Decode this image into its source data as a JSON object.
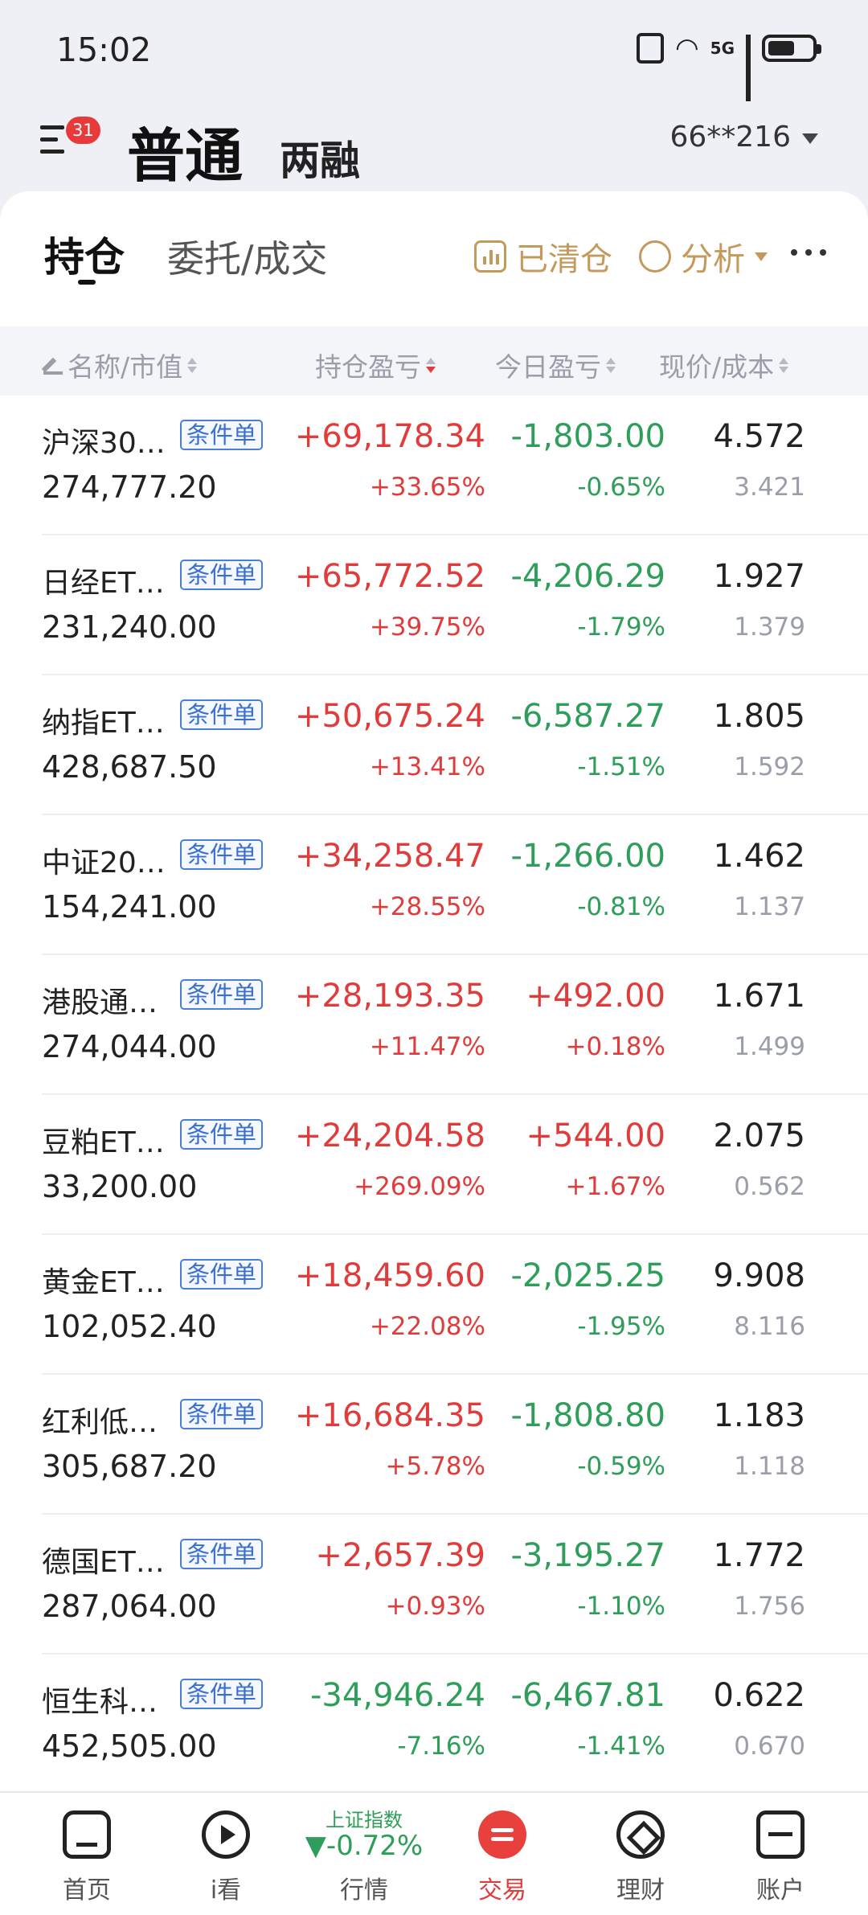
{
  "status": {
    "time": "15:02",
    "network": "5G"
  },
  "header": {
    "badge_count": "31",
    "account_type": "普通",
    "account_type_alt": "两融",
    "account_number": "66**216"
  },
  "tabs": {
    "active": "持仓",
    "inactive": "委托/成交"
  },
  "tools": {
    "cleared": "已清仓",
    "analysis": "分析"
  },
  "columns": {
    "name": "名称/市值",
    "pl": "持仓盈亏",
    "today": "今日盈亏",
    "price": "现价/成本"
  },
  "tag_label": "条件单",
  "holdings": [
    {
      "name": "沪深30…",
      "market_value": "274,777.20",
      "pl": "+69,178.34",
      "pl_pct": "+33.65%",
      "today": "-1,803.00",
      "today_pct": "-0.65%",
      "price": "4.572",
      "cost": "3.421"
    },
    {
      "name": "日经ET…",
      "market_value": "231,240.00",
      "pl": "+65,772.52",
      "pl_pct": "+39.75%",
      "today": "-4,206.29",
      "today_pct": "-1.79%",
      "price": "1.927",
      "cost": "1.379"
    },
    {
      "name": "纳指ET…",
      "market_value": "428,687.50",
      "pl": "+50,675.24",
      "pl_pct": "+13.41%",
      "today": "-6,587.27",
      "today_pct": "-1.51%",
      "price": "1.805",
      "cost": "1.592"
    },
    {
      "name": "中证20…",
      "market_value": "154,241.00",
      "pl": "+34,258.47",
      "pl_pct": "+28.55%",
      "today": "-1,266.00",
      "today_pct": "-0.81%",
      "price": "1.462",
      "cost": "1.137"
    },
    {
      "name": "港股通…",
      "market_value": "274,044.00",
      "pl": "+28,193.35",
      "pl_pct": "+11.47%",
      "today": "+492.00",
      "today_pct": "+0.18%",
      "price": "1.671",
      "cost": "1.499"
    },
    {
      "name": "豆粕ET…",
      "market_value": "33,200.00",
      "pl": "+24,204.58",
      "pl_pct": "+269.09%",
      "today": "+544.00",
      "today_pct": "+1.67%",
      "price": "2.075",
      "cost": "0.562"
    },
    {
      "name": "黄金ET…",
      "market_value": "102,052.40",
      "pl": "+18,459.60",
      "pl_pct": "+22.08%",
      "today": "-2,025.25",
      "today_pct": "-1.95%",
      "price": "9.908",
      "cost": "8.116"
    },
    {
      "name": "红利低…",
      "market_value": "305,687.20",
      "pl": "+16,684.35",
      "pl_pct": "+5.78%",
      "today": "-1,808.80",
      "today_pct": "-0.59%",
      "price": "1.183",
      "cost": "1.118"
    },
    {
      "name": "德国ET…",
      "market_value": "287,064.00",
      "pl": "+2,657.39",
      "pl_pct": "+0.93%",
      "today": "-3,195.27",
      "today_pct": "-1.10%",
      "price": "1.772",
      "cost": "1.756"
    },
    {
      "name": "恒生科…",
      "market_value": "452,505.00",
      "pl": "-34,946.24",
      "pl_pct": "-7.16%",
      "today": "-6,467.81",
      "today_pct": "-1.41%",
      "price": "0.622",
      "cost": "0.670"
    }
  ],
  "nav": {
    "home": "首页",
    "watch": "i看",
    "market_index_name": "上证指数",
    "market_index_value": "▼-0.72%",
    "market": "行情",
    "trade": "交易",
    "finance": "理财",
    "account": "账户"
  },
  "colors": {
    "up": "#e03c3c",
    "down": "#2e9e5a",
    "accent": "#c49a5c",
    "tag": "#3a6fd0"
  }
}
